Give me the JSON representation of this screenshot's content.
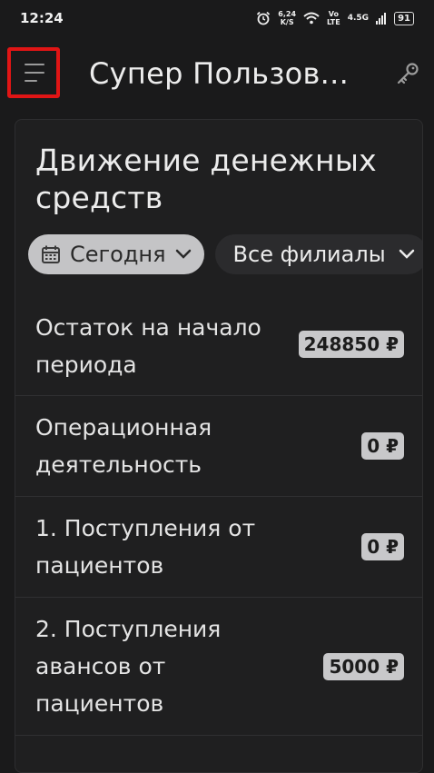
{
  "status_bar": {
    "time": "12:24",
    "net_speed_top": "6,24",
    "net_speed_bottom": "K/S",
    "volte_top": "Vo",
    "volte_bottom": "LTE",
    "signal": "4.5G",
    "battery": "91"
  },
  "app_bar": {
    "title": "Супер Пользов..."
  },
  "card": {
    "title": "Движение денежных средств"
  },
  "filters": {
    "period": "Сегодня",
    "branch": "Все филиалы"
  },
  "rows": [
    {
      "label": "Остаток на начало периода",
      "value": "248850 ₽"
    },
    {
      "label": "Операционная деятельность",
      "value": "0 ₽"
    },
    {
      "label": "1. Поступления от пациентов",
      "value": "0 ₽"
    },
    {
      "label": "2. Поступления авансов от пациентов",
      "value": "5000 ₽"
    }
  ]
}
